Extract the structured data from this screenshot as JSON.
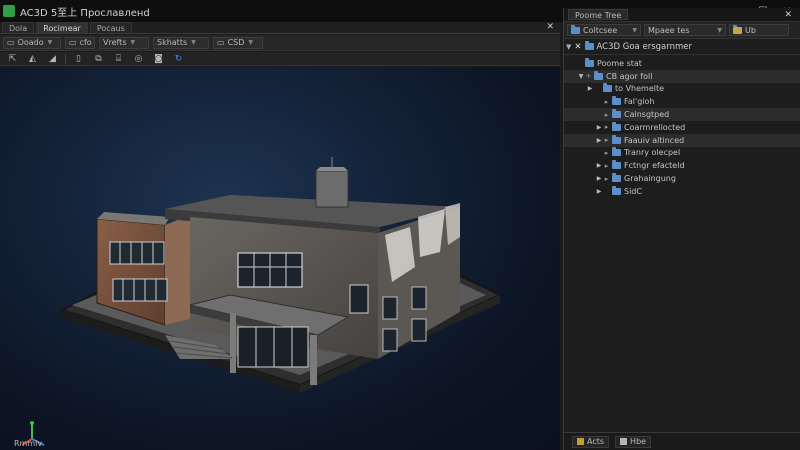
{
  "window": {
    "title": "AC3D 5至上 Прославленd",
    "controls": [
      "—",
      "☐",
      "✕"
    ]
  },
  "left_pane": {
    "tabs": [
      "Dola",
      "Rocimear",
      "Pocaus"
    ],
    "close": "✕",
    "toolbar1": [
      {
        "icon": "▭",
        "label": "Ooado"
      },
      {
        "icon": "▭",
        "label": "cfo"
      },
      {
        "icon": "",
        "label": "Vrefts"
      },
      {
        "icon": "",
        "label": "Skhatts"
      },
      {
        "icon": "▭",
        "label": "CSD"
      }
    ],
    "toolbar2_icons": [
      "move-icon",
      "scale-icon",
      "rotate-icon",
      "page-icon",
      "cube-icon",
      "cylinder-icon",
      "sphere-icon",
      "camera-icon",
      "refresh-icon"
    ],
    "status": "Rmmlv"
  },
  "right_pane": {
    "title_tab": "Poome Tree",
    "close": "✕",
    "toolbar": [
      {
        "label": "Coltcsee"
      },
      {
        "label": "Mpaee tes"
      },
      {
        "label": "Ub"
      }
    ],
    "header": "AC3D Goa ersgarnmer",
    "tree": [
      {
        "label": "Poome stat",
        "indent": 0,
        "caret": "",
        "check": ""
      },
      {
        "label": "CB agor foll",
        "indent": 1,
        "caret": "▼",
        "check": "+"
      },
      {
        "label": "to Vhemelte",
        "indent": 2,
        "caret": "▶",
        "check": ""
      },
      {
        "label": "Fal'gioh",
        "indent": 3,
        "caret": "",
        "check": "▸"
      },
      {
        "label": "Calnsgtped",
        "indent": 3,
        "caret": "",
        "check": "▸"
      },
      {
        "label": "Coarmrellocted",
        "indent": 3,
        "caret": "▶",
        "check": "▸"
      },
      {
        "label": "Faauiv altinced",
        "indent": 3,
        "caret": "▶",
        "check": "▸"
      },
      {
        "label": "Tranry olecpel",
        "indent": 3,
        "caret": "",
        "check": "▸"
      },
      {
        "label": "Fctngr efacteld",
        "indent": 3,
        "caret": "▶",
        "check": "▸"
      },
      {
        "label": "Grahaingung",
        "indent": 3,
        "caret": "▶",
        "check": "▸"
      },
      {
        "label": "SidC",
        "indent": 3,
        "caret": "▶",
        "check": ""
      }
    ],
    "footer_tabs": [
      "Acts",
      "Hbe"
    ]
  }
}
